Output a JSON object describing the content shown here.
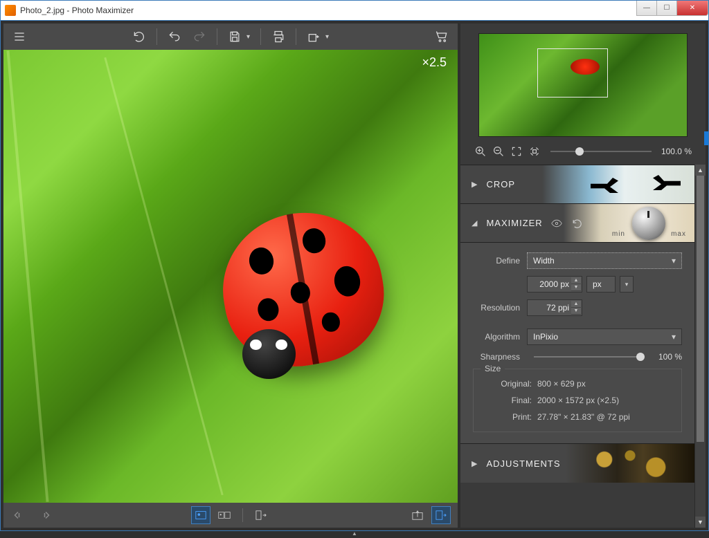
{
  "title": "Photo_2.jpg - Photo Maximizer",
  "toolbar": {
    "hamburger": "menu-icon",
    "reset": "reset-icon",
    "undo": "undo-icon",
    "redo": "redo-icon",
    "save": "save-icon",
    "print": "print-icon",
    "share": "share-icon",
    "cart": "cart-icon"
  },
  "canvas": {
    "zoom_label": "×2.5"
  },
  "bottombar": {
    "prevarrow": "prev-arrows-icon",
    "nextarrow": "next-arrows-icon",
    "single": "single-view-icon",
    "compare": "compare-view-icon",
    "export": "apply-icon",
    "import": "open-icon",
    "exportside": "export-side-icon"
  },
  "preview": {
    "zoomout": "zoom-out-icon",
    "zoomin": "zoom-in-icon",
    "fit": "fit-icon",
    "actual": "actual-size-icon",
    "zoom_value": "100.0 %"
  },
  "sections": {
    "crop": {
      "label": "CROP"
    },
    "maximizer": {
      "label": "MAXIMIZER",
      "min": "min",
      "max": "max",
      "define_label": "Define",
      "define_value": "Width",
      "width_value": "2000 px",
      "unit_value": "px",
      "resolution_label": "Resolution",
      "resolution_value": "72 ppi",
      "algorithm_label": "Algorithm",
      "algorithm_value": "InPixio",
      "sharpness_label": "Sharpness",
      "sharpness_value": "100 %",
      "size": {
        "title": "Size",
        "original_label": "Original:",
        "original_value": "800 × 629 px",
        "final_label": "Final:",
        "final_value": "2000 × 1572 px (×2.5)",
        "print_label": "Print:",
        "print_value": "27.78\" × 21.83\" @ 72 ppi"
      }
    },
    "adjustments": {
      "label": "ADJUSTMENTS"
    }
  }
}
